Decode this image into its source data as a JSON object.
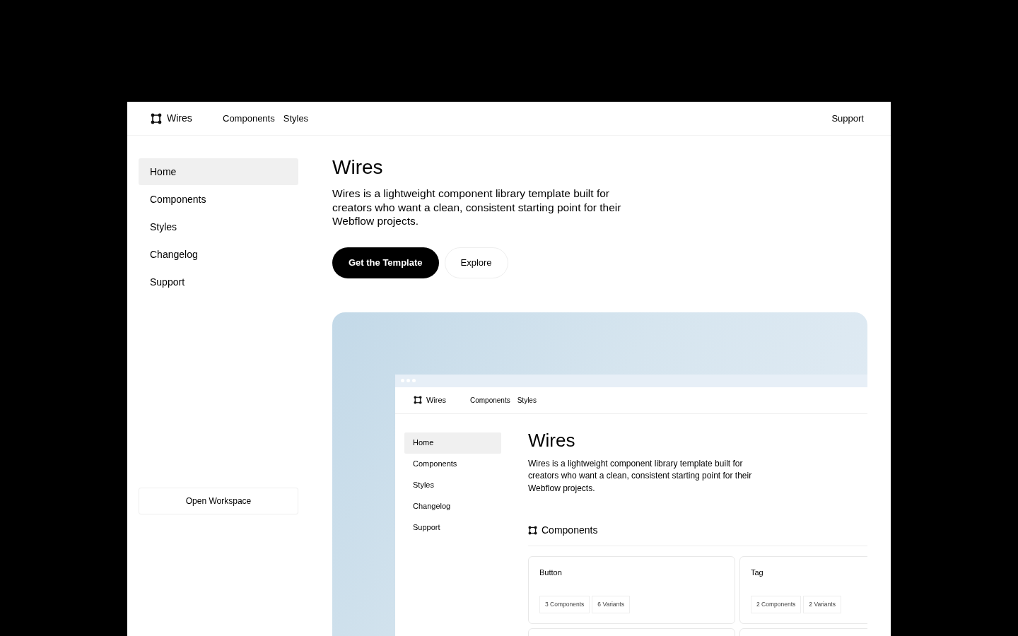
{
  "header": {
    "brand": "Wires",
    "nav": [
      "Components",
      "Styles"
    ],
    "support": "Support"
  },
  "sidebar": {
    "items": [
      {
        "label": "Home",
        "selected": true
      },
      {
        "label": "Components",
        "selected": false
      },
      {
        "label": "Styles",
        "selected": false
      },
      {
        "label": "Changelog",
        "selected": false
      },
      {
        "label": "Support",
        "selected": false
      }
    ],
    "footer_button": "Open Workspace"
  },
  "hero": {
    "title": "Wires",
    "description": "Wires is a lightweight component library template built for creators who want a clean, consistent starting point for their Webflow projects.",
    "buttons": [
      {
        "label": "Get the Template",
        "kind": "primary"
      },
      {
        "label": "Explore",
        "kind": "secondary"
      }
    ]
  },
  "preview": {
    "header": {
      "brand": "Wires",
      "nav": [
        "Components",
        "Styles"
      ]
    },
    "sidebar": {
      "items": [
        {
          "label": "Home",
          "selected": true
        },
        {
          "label": "Components",
          "selected": false
        },
        {
          "label": "Styles",
          "selected": false
        },
        {
          "label": "Changelog",
          "selected": false
        },
        {
          "label": "Support",
          "selected": false
        }
      ]
    },
    "title": "Wires",
    "description": "Wires is a lightweight component library template built for creators who want a clean, consistent starting point for their Webflow projects.",
    "section_title": "Components",
    "cards": [
      {
        "title": "Button",
        "tags": [
          "3 Components",
          "6 Variants"
        ]
      },
      {
        "title": "Tag",
        "tags": [
          "2 Components",
          "2 Variants"
        ]
      }
    ]
  }
}
